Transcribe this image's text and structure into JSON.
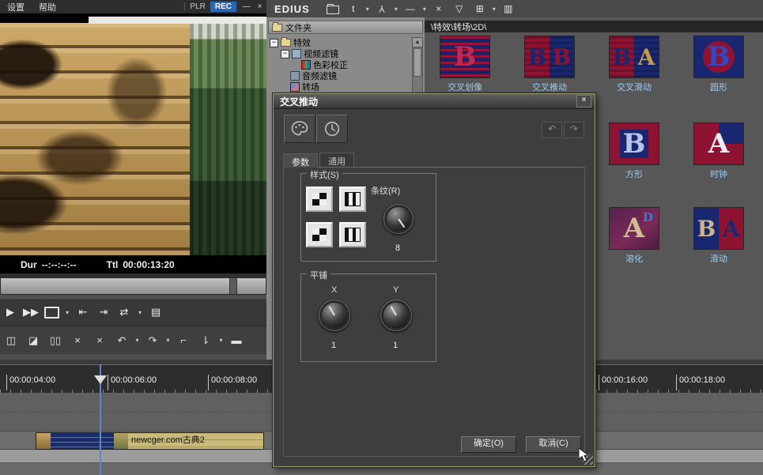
{
  "preview": {
    "menu_items": [
      "设置",
      "帮助"
    ],
    "plr_label": "PLR",
    "rec_label": "REC",
    "minimize_glyph": "—",
    "close_glyph": "×",
    "dur_label": "Dur",
    "dur_value": "--:--:--:--",
    "ttl_label": "Ttl",
    "ttl_value": "00:00:13:20"
  },
  "toolbar": {
    "logo": "EDIUS",
    "caret_glyph": "▾",
    "icons": [
      {
        "name": "open-folder-icon",
        "glyph": ""
      },
      {
        "name": "text-tool-icon",
        "glyph": "t"
      },
      {
        "name": "add-sequence-icon",
        "glyph": "Y"
      },
      {
        "name": "line-tool-icon",
        "glyph": "—"
      },
      {
        "name": "delete-icon",
        "glyph": "×"
      },
      {
        "name": "effects-flask-icon",
        "glyph": "▽"
      },
      {
        "name": "grid-icon",
        "glyph": "⊞"
      },
      {
        "name": "capture-icon",
        "glyph": "▥"
      }
    ]
  },
  "transport": {
    "icons": [
      {
        "name": "play-icon",
        "glyph": "▶"
      },
      {
        "name": "fast-forward-icon",
        "glyph": "▶▶"
      },
      {
        "name": "mark-in-icon",
        "glyph": "⇤"
      },
      {
        "name": "mark-out-icon",
        "glyph": "⇥"
      },
      {
        "name": "loop-icon",
        "glyph": "⇄"
      },
      {
        "name": "export-icon",
        "glyph": "▤"
      }
    ]
  },
  "edit_tools": {
    "icons": [
      {
        "name": "copy-icon",
        "glyph": "◫"
      },
      {
        "name": "paste-icon",
        "glyph": "◪"
      },
      {
        "name": "clips-icon",
        "glyph": "▯▯"
      },
      {
        "name": "cut-icon",
        "glyph": "×"
      },
      {
        "name": "ripple-cut-icon",
        "glyph": "×"
      },
      {
        "name": "undo-icon",
        "glyph": "↶"
      },
      {
        "name": "redo-icon",
        "glyph": "↷"
      },
      {
        "name": "corner-icon",
        "glyph": "⌐"
      },
      {
        "name": "down-arrow-icon",
        "glyph": "⇂"
      },
      {
        "name": "render-icon",
        "glyph": "▬"
      }
    ]
  },
  "bin": {
    "header": "文件夹",
    "expander_glyph": "−",
    "scroll_up_glyph": "▲",
    "tree": [
      {
        "label": "特效"
      },
      {
        "label": "视频滤镜"
      },
      {
        "label": "色彩校正"
      },
      {
        "label": "音频滤镜"
      },
      {
        "label": "转场"
      }
    ]
  },
  "palette": {
    "path": "\\特效\\转场\\2D\\",
    "effects": [
      {
        "label": "交叉划像",
        "letter": "B"
      },
      {
        "label": "交叉推动",
        "letter_left": "B",
        "letter_right": "B"
      },
      {
        "label": "交叉滑动",
        "letter_left": "B",
        "letter_right": "A"
      },
      {
        "label": "圆形",
        "letter": "B"
      },
      {
        "label": "方形",
        "letter": "B"
      },
      {
        "label": "时钟",
        "letter": "A"
      },
      {
        "label": "溶化",
        "letter": "A",
        "letter_sub": "D"
      },
      {
        "label": "滑动",
        "letter_left": "B",
        "letter_right": "A"
      }
    ]
  },
  "dialog": {
    "title": "交叉推动",
    "close_glyph": "×",
    "undo_glyph": "↶",
    "redo_glyph": "↷",
    "tabs": [
      {
        "label": "参数"
      },
      {
        "label": "通用"
      }
    ],
    "style_group": {
      "legend": "样式(S)",
      "stripes_label": "条纹(R)",
      "stripes_value": "8"
    },
    "tile_group": {
      "legend": "平铺",
      "x_label": "X",
      "y_label": "Y",
      "x_value": "1",
      "y_value": "1"
    },
    "ok_label": "确定(O)",
    "cancel_label": "取消(C)"
  },
  "timeline": {
    "ticks": [
      {
        "label": "00:00:04:00"
      },
      {
        "label": "00:00:06:00"
      },
      {
        "label": "00:00:08:00"
      },
      {
        "label": "00:00:16:00"
      },
      {
        "label": "00:00:18:00"
      }
    ],
    "clip_name": "newcger.com古典2"
  },
  "colors": {
    "accent_blue": "#2f66b0",
    "effect_red": "#8e1232",
    "effect_navy": "#18276f",
    "label_blue": "#9ecbf2",
    "playhead_blue": "#5b87c5"
  }
}
